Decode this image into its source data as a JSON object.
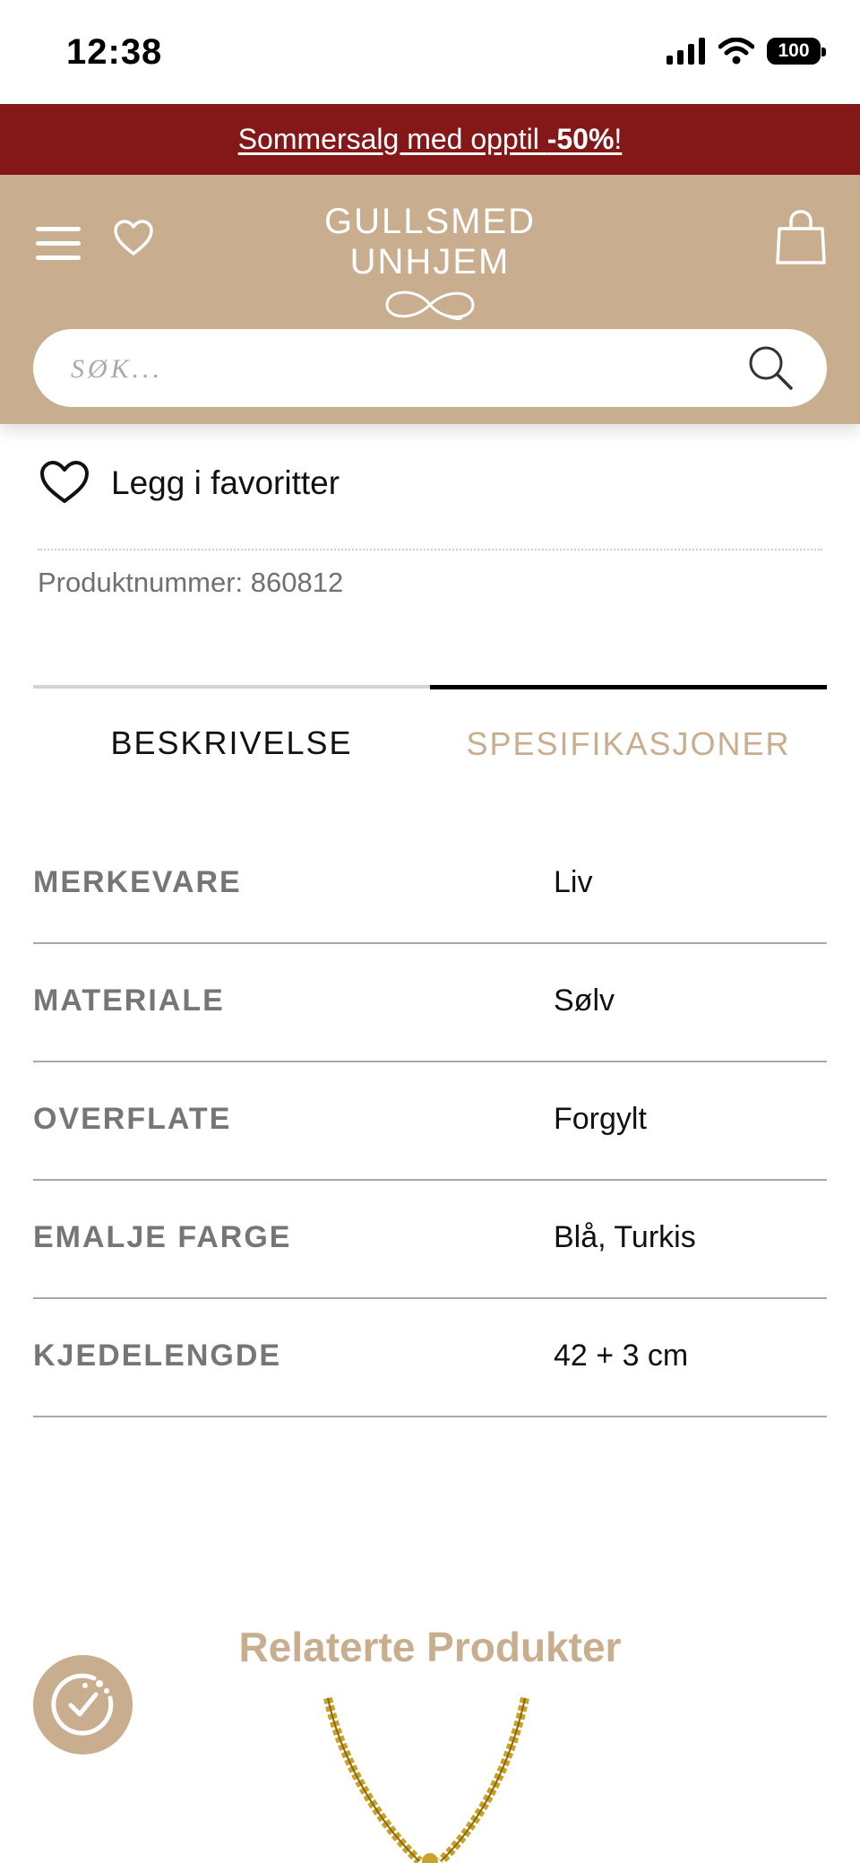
{
  "status_bar": {
    "time": "12:38",
    "battery": "100"
  },
  "promo": {
    "text_prefix": "Sommersalg med opptil ",
    "text_bold": "-50%",
    "text_suffix": "!"
  },
  "header": {
    "logo_text": "GULLSMED UNHJEM",
    "search_placeholder": "SØK...",
    "icons": [
      "menu-icon",
      "heart-icon",
      "shopping-bag-icon",
      "search-icon"
    ],
    "background_color": "#c8ad8f"
  },
  "product": {
    "favorite_label": "Legg i favoritter",
    "product_number": "Produktnummer: 860812"
  },
  "tabs": [
    {
      "label": "BESKRIVELSE",
      "active": false
    },
    {
      "label": "SPESIFIKASJONER",
      "active": true
    }
  ],
  "specs": [
    {
      "label": "MERKEVARE",
      "value": "Liv"
    },
    {
      "label": "MATERIALE",
      "value": "Sølv"
    },
    {
      "label": "OVERFLATE",
      "value": "Forgylt"
    },
    {
      "label": "EMALJE FARGE",
      "value": "Blå, Turkis"
    },
    {
      "label": "KJEDELENGDE",
      "value": "42 + 3 cm"
    }
  ],
  "related": {
    "title": "Relaterte Produkter"
  },
  "colors": {
    "promo_bg": "#841819",
    "accent": "#c8ad8f",
    "spec_label": "#767676"
  }
}
